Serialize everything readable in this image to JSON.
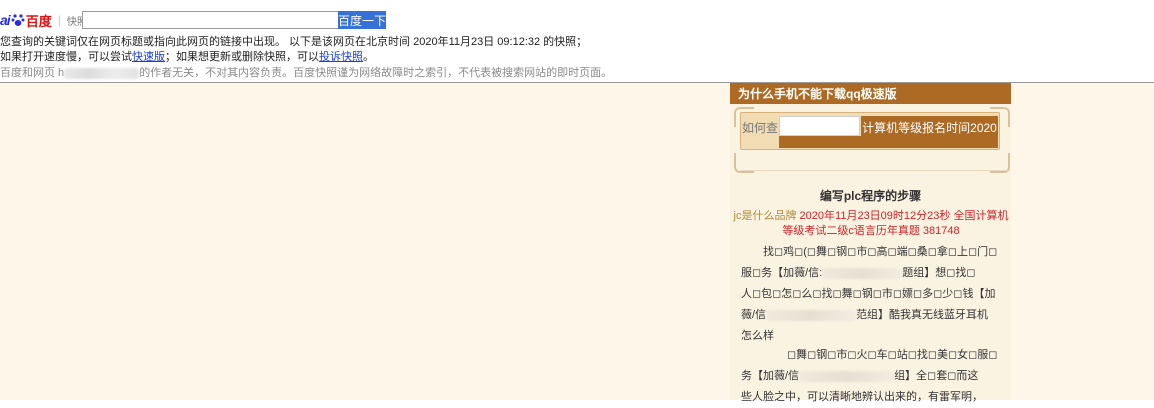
{
  "header": {
    "logo_brand": "ai",
    "logo_baidu": "百度",
    "logo_kuaizhao": "快照",
    "search_value": "",
    "search_button": "百度一下",
    "notice_line1": "您查询的关键词仅在网页标题或指向此网页的链接中出现。 以下是该网页在北京时间 2020年11月23日 09:12:32 的快照；",
    "notice_line2_pre": "如果打开速度慢，可以尝试",
    "notice_line2_link1": "快速版",
    "notice_line2_mid": "；如果想更新或删除快照，可以",
    "notice_line2_link2": "投诉快照",
    "notice_line2_post": "。",
    "notice_line3_pre": "百度和网页 h",
    "notice_line3_post": "的作者无关，不对其内容负责。百度快照谨为网络故障时之索引，不代表被搜索网站的即时页面。"
  },
  "sidebar": {
    "title": "为什么手机不能下载qq极速版",
    "how_label": "如何查",
    "button_label": "计算机等级报名时间2020"
  },
  "article": {
    "title": "编写plc程序的步骤",
    "meta_line1_jc": "jc是什么品牌",
    "meta_line1_rest": " 2020年11月23日09时12分23秒 全国计算机",
    "meta_line2": "等级考试二级c语言历年真题 381748",
    "p1_l1": "找◻鸡◻(◻舞◻钢◻市◻高◻端◻桑◻拿◻上◻门◻",
    "p1_l2a": "服◻务【加薇/信:",
    "p1_l2b": "题组】想◻找◻",
    "p1_l3": "人◻包◻怎◻么◻找◻舞◻钢◻市◻嫖◻多◻少◻钱【加",
    "p1_l4a": "薇/信",
    "p1_l4b": "范组】酷我真无线蓝牙耳机",
    "p1_l5": "怎么样",
    "p2_l1": "◻舞◻钢◻市◻火◻车◻站◻找◻美◻女◻服◻",
    "p2_l2a": "务【加薇/信",
    "p2_l2b": "组】全◻套◻而这",
    "p2_l3": "些人脸之中，可以清晰地辨认出来的，有雷军明，"
  },
  "colors": {
    "sidebar_brown": "#ad6a24",
    "page_bg": "#fdf6e9",
    "link_blue": "#1a3ed4",
    "search_blue": "#3571d6",
    "meta_red": "#d0222a"
  }
}
